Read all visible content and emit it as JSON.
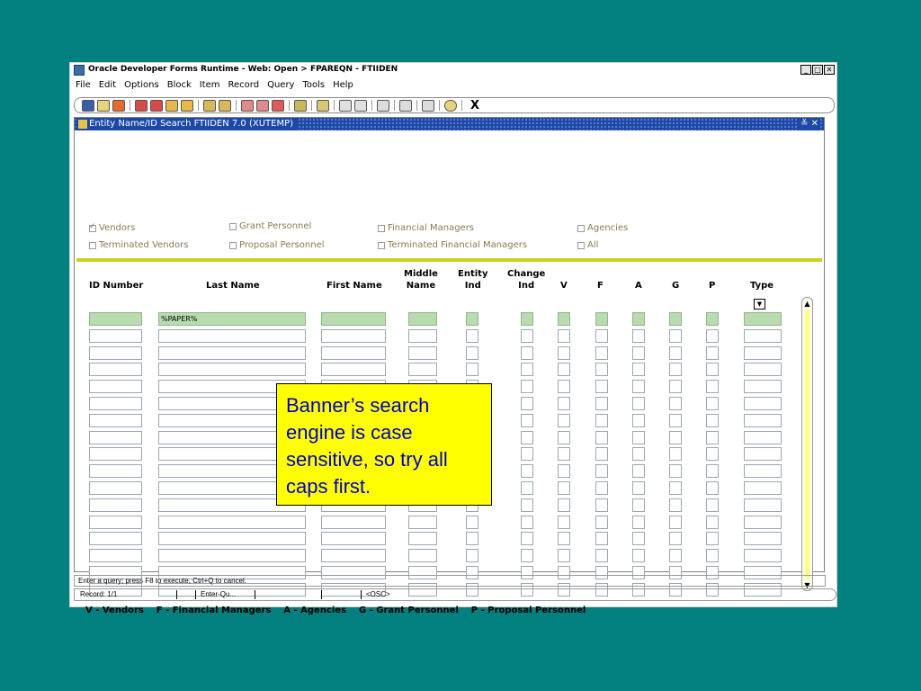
{
  "window": {
    "title": "Oracle Developer Forms Runtime - Web:  Open > FPAREQN - FTIIDEN",
    "buttons": [
      "_",
      "□",
      "✕"
    ]
  },
  "menu": [
    "File",
    "Edit",
    "Options",
    "Block",
    "Item",
    "Record",
    "Query",
    "Tools",
    "Help"
  ],
  "toolbar": {
    "close_label": "X"
  },
  "form": {
    "title": "Entity Name/ID Search  FTIIDEN  7.0  (XUTEMP)",
    "controls": "≚ ✕",
    "options": [
      {
        "label": "Vendors",
        "checked": true
      },
      {
        "label": "Grant Personnel",
        "checked": false
      },
      {
        "label": "Financial Managers",
        "checked": false
      },
      {
        "label": "Agencies",
        "checked": false
      },
      {
        "label": "Terminated Vendors",
        "checked": false
      },
      {
        "label": "Proposal Personnel",
        "checked": false
      },
      {
        "label": "Terminated Financial Managers",
        "checked": false
      },
      {
        "label": "All",
        "checked": false
      }
    ],
    "columns": {
      "id": "ID Number",
      "last": "Last Name",
      "first": "First Name",
      "middle": "Middle\nName",
      "entity": "Entity\nInd",
      "change": "Change\nInd",
      "v": "V",
      "f": "F",
      "a": "A",
      "g": "G",
      "p": "P",
      "type": "Type"
    },
    "query_last_name": "%PAPER%",
    "row_count": 17,
    "legend": "V - Vendors    F - Financial Managers    A - Agencies    G - Grant Personnel    P - Proposal Personnel"
  },
  "status": {
    "message": "Enter a query;  press F8 to execute, Ctrl+Q to cancel.",
    "record": "Record: 1/1",
    "mode": "Enter-Qu...",
    "osc": "<OSC>"
  },
  "note": "Banner’s search engine is case sensitive, so try all caps first.",
  "colors": {
    "desktop": "#027f7f",
    "form_title": "#1c48a8",
    "query_cell": "#b8dbb0",
    "note_bg": "#ffff00",
    "note_text": "#0000c8"
  }
}
